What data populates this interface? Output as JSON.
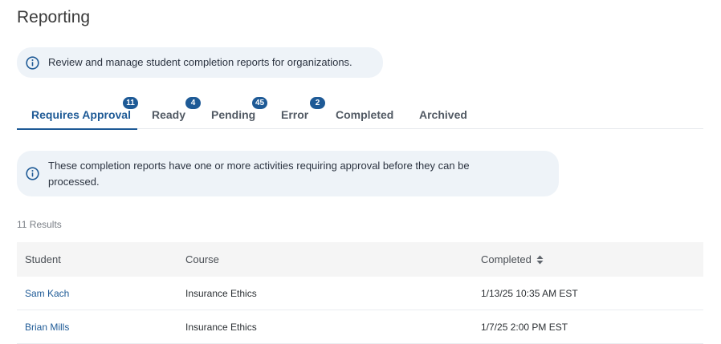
{
  "page": {
    "title": "Reporting"
  },
  "intro": {
    "text": "Review and manage student completion reports for organizations."
  },
  "tabs": [
    {
      "label": "Requires Approval",
      "badge": "11",
      "active": true
    },
    {
      "label": "Ready",
      "badge": "4"
    },
    {
      "label": "Pending",
      "badge": "45"
    },
    {
      "label": "Error",
      "badge": "2"
    },
    {
      "label": "Completed",
      "badge": ""
    },
    {
      "label": "Archived",
      "badge": ""
    }
  ],
  "tab_info": {
    "text": "These completion reports have one or more activities requiring approval before they can be processed."
  },
  "results": {
    "label": "11 Results"
  },
  "table": {
    "headers": {
      "student": "Student",
      "course": "Course",
      "completed": "Completed"
    },
    "rows": [
      {
        "student": "Sam Kach",
        "course": "Insurance Ethics",
        "completed": "1/13/25 10:35 AM EST"
      },
      {
        "student": "Brian Mills",
        "course": "Insurance Ethics",
        "completed": "1/7/25 2:00 PM EST"
      }
    ]
  },
  "colors": {
    "accent": "#1e5a96",
    "info_bg": "#eef3f8",
    "header_bg": "#f5f5f5"
  },
  "icons": {
    "info": "info-circle-icon",
    "sort": "sort-arrows-icon"
  }
}
